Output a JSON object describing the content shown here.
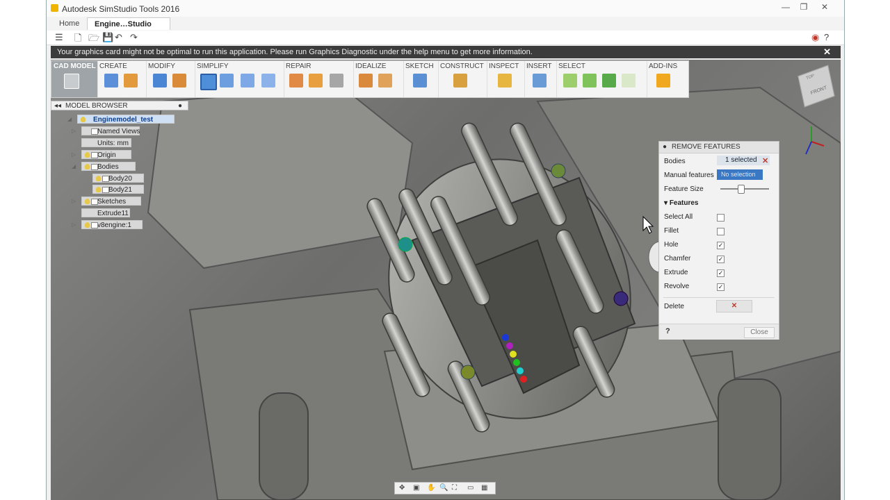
{
  "window": {
    "title": "Autodesk SimStudio Tools 2016",
    "controls": [
      "minimize",
      "maximize",
      "close"
    ]
  },
  "tabs": [
    {
      "label": "Home"
    },
    {
      "label": "Engine…Studio",
      "close": "✕"
    }
  ],
  "message": {
    "text": "Your graphics card might not be optimal to run this application. Please run Graphics Diagnostic under the help menu to get more information.",
    "close": "✕"
  },
  "toolbar": {
    "groups": [
      "CAD MODEL",
      "CREATE",
      "MODIFY",
      "SIMPLIFY",
      "REPAIR",
      "IDEALIZE",
      "SKETCH",
      "CONSTRUCT",
      "INSPECT",
      "INSERT",
      "SELECT",
      "ADD-INS"
    ]
  },
  "browser": {
    "title": "MODEL BROWSER",
    "nodes": [
      {
        "label": "Enginemodel_test"
      },
      {
        "label": "Named Views"
      },
      {
        "label": "Units: mm"
      },
      {
        "label": "Origin"
      },
      {
        "label": "Bodies"
      },
      {
        "label": "Body20"
      },
      {
        "label": "Body21"
      },
      {
        "label": "Sketches"
      },
      {
        "label": "Extrude11"
      },
      {
        "label": "v8engine:1"
      }
    ]
  },
  "panel": {
    "title": "REMOVE FEATURES",
    "bodies_label": "Bodies",
    "bodies_value": "1 selected",
    "manual_label": "Manual features",
    "manual_value": "No selection",
    "feature_size_label": "Feature Size",
    "feature_size_level": 0.4,
    "features_header": "Features",
    "features": [
      {
        "label": "Select All",
        "checked": false
      },
      {
        "label": "Fillet",
        "checked": false
      },
      {
        "label": "Hole",
        "checked": true
      },
      {
        "label": "Chamfer",
        "checked": true
      },
      {
        "label": "Extrude",
        "checked": true
      },
      {
        "label": "Revolve",
        "checked": true
      }
    ],
    "delete_label": "Delete",
    "close_label": "Close"
  },
  "viewcube": {
    "top": "TOP",
    "front": "FRONT"
  },
  "colors": {
    "message_bar": "#3c3c3c",
    "accent_blue": "#3b78c4",
    "delete_red": "#c0392b"
  }
}
